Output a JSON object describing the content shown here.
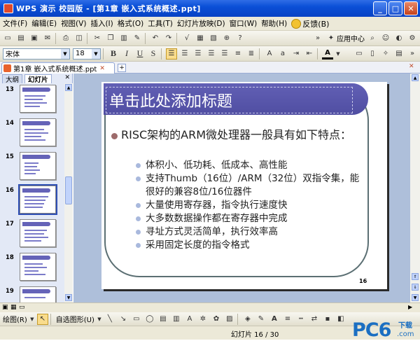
{
  "window": {
    "title": "WPS 演示 校园版 - [第1章 嵌入式系统概述.ppt]"
  },
  "menu": {
    "items": [
      "文件(F)",
      "编辑(E)",
      "视图(V)",
      "插入(I)",
      "格式(O)",
      "工具(T)",
      "幻灯片放映(D)",
      "窗口(W)",
      "帮助(H)"
    ],
    "feedback": "反馈(B)"
  },
  "toolbar": {
    "app_center": "应用中心"
  },
  "format": {
    "font": "宋体",
    "size": "18",
    "bold": "B",
    "italic": "I",
    "underline": "U",
    "shadow": "S"
  },
  "tabs": {
    "document": "第1章 嵌入式系统概述.ppt"
  },
  "pane": {
    "tab_outline": "大纲",
    "tab_slides": "幻灯片"
  },
  "thumbnails": [
    {
      "num": "13",
      "selected": false
    },
    {
      "num": "14",
      "selected": false
    },
    {
      "num": "15",
      "selected": false
    },
    {
      "num": "16",
      "selected": true
    },
    {
      "num": "17",
      "selected": false
    },
    {
      "num": "18",
      "selected": false
    },
    {
      "num": "19",
      "selected": false
    }
  ],
  "slide": {
    "title_placeholder": "单击此处添加标题",
    "bullet_main": "RISC架构的ARM微处理器一般具有如下特点：",
    "bullets": [
      "体积小、低功耗、低成本、高性能",
      "支持Thumb（16位）/ARM（32位）双指令集，能很好的兼容8位/16位器件",
      "大量使用寄存器，指令执行速度快",
      "大多数数据操作都在寄存器中完成",
      "寻址方式灵活简单，执行效率高",
      "采用固定长度的指令格式"
    ],
    "page_number": "16"
  },
  "drawbar": {
    "draw": "绘图(R)",
    "autoshapes": "自选图形(U)"
  },
  "status": {
    "slide_info": "幻灯片 16 / 30"
  },
  "watermark": {
    "brand": "PC6",
    "download": "下载",
    "domain": ".com"
  },
  "colors": {
    "titlebar": "#0a4fd7",
    "slide_title_bg": "#5b59ac",
    "canvas": "#aebfda"
  }
}
